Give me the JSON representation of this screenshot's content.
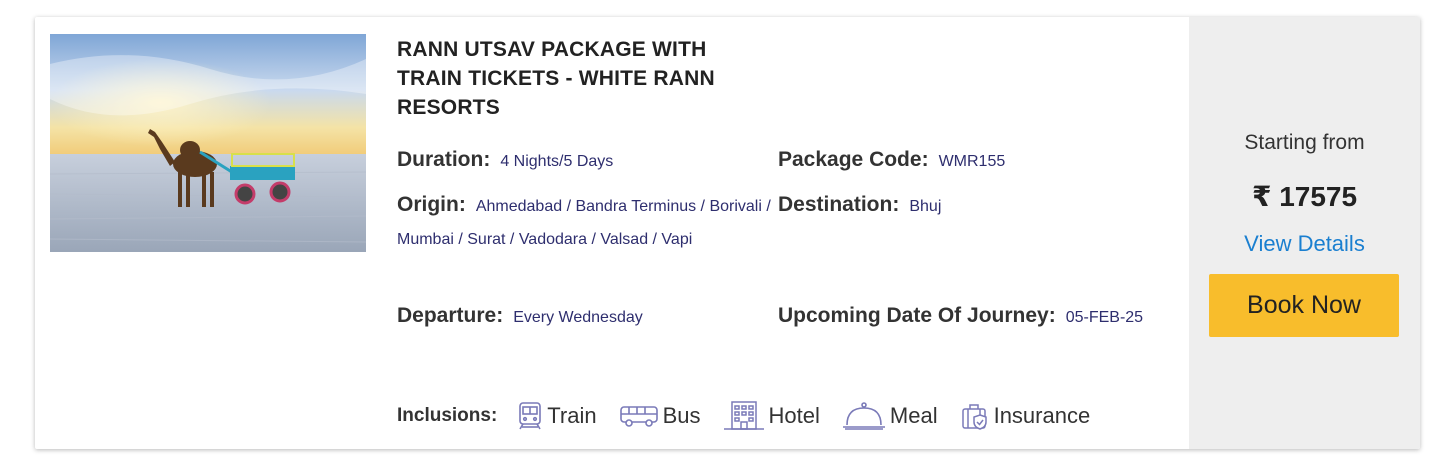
{
  "package": {
    "title": "RANN UTSAV PACKAGE WITH TRAIN TICKETS - WHITE RANN RESORTS",
    "duration": {
      "label": "Duration:",
      "value": "4 Nights/5 Days"
    },
    "package_code": {
      "label": "Package Code:",
      "value": "WMR155"
    },
    "origin": {
      "label": "Origin:",
      "value": "Ahmedabad / Bandra Terminus / Borivali / Mumbai / Surat / Vadodara / Valsad / Vapi"
    },
    "destination": {
      "label": "Destination:",
      "value": "Bhuj"
    },
    "departure": {
      "label": "Departure:",
      "value": "Every Wednesday"
    },
    "upcoming": {
      "label": "Upcoming Date Of Journey:",
      "value": "05-FEB-25"
    }
  },
  "inclusions": {
    "label": "Inclusions:",
    "items": [
      {
        "icon": "train-icon",
        "label": "Train"
      },
      {
        "icon": "bus-icon",
        "label": "Bus"
      },
      {
        "icon": "hotel-icon",
        "label": "Hotel"
      },
      {
        "icon": "meal-icon",
        "label": "Meal"
      },
      {
        "icon": "insurance-icon",
        "label": "Insurance"
      }
    ]
  },
  "pricing": {
    "starting_label": "Starting from",
    "price": "₹ 17575",
    "view_details": "View Details",
    "book_now": "Book Now"
  },
  "colors": {
    "accent_button": "#f8bd2c",
    "link": "#1a7fd0",
    "value_text": "#2e2e6e",
    "icon": "#7a7ab8"
  }
}
